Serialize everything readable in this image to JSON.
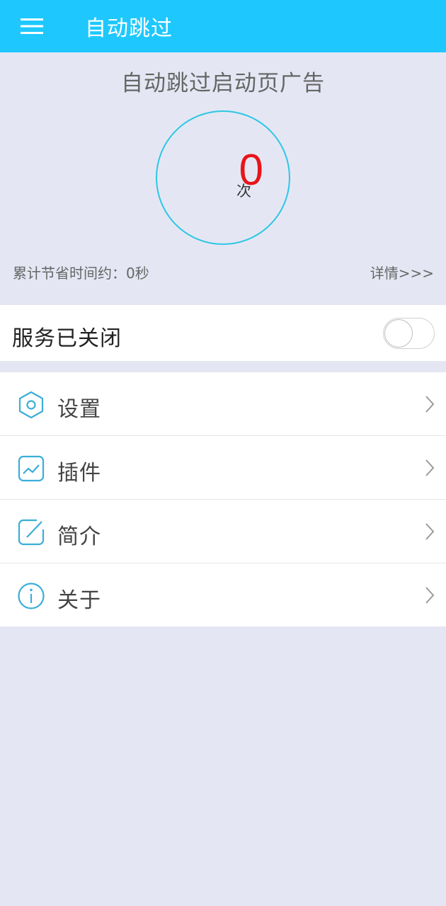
{
  "app_bar": {
    "menu_icon": "hamburger-menu-icon",
    "title": "自动跳过",
    "background_color": "#1ec8ff"
  },
  "stats": {
    "title": "自动跳过启动页广告",
    "count": "0",
    "count_unit": "次",
    "saved_time": "累计节省时间约：0秒",
    "details_link": "详情>>>",
    "count_color": "#e8141b",
    "ring_color": "#2ec6e6"
  },
  "service": {
    "label": "服务已关闭",
    "enabled": false
  },
  "menu": {
    "items": [
      {
        "label": "设置",
        "icon": "settings-hexagon-icon"
      },
      {
        "label": "插件",
        "icon": "plugin-chart-icon"
      },
      {
        "label": "简介",
        "icon": "intro-edit-icon"
      },
      {
        "label": "关于",
        "icon": "about-info-icon"
      }
    ],
    "chevron_icon": "chevron-right-icon",
    "icon_color": "#3aaed8"
  }
}
